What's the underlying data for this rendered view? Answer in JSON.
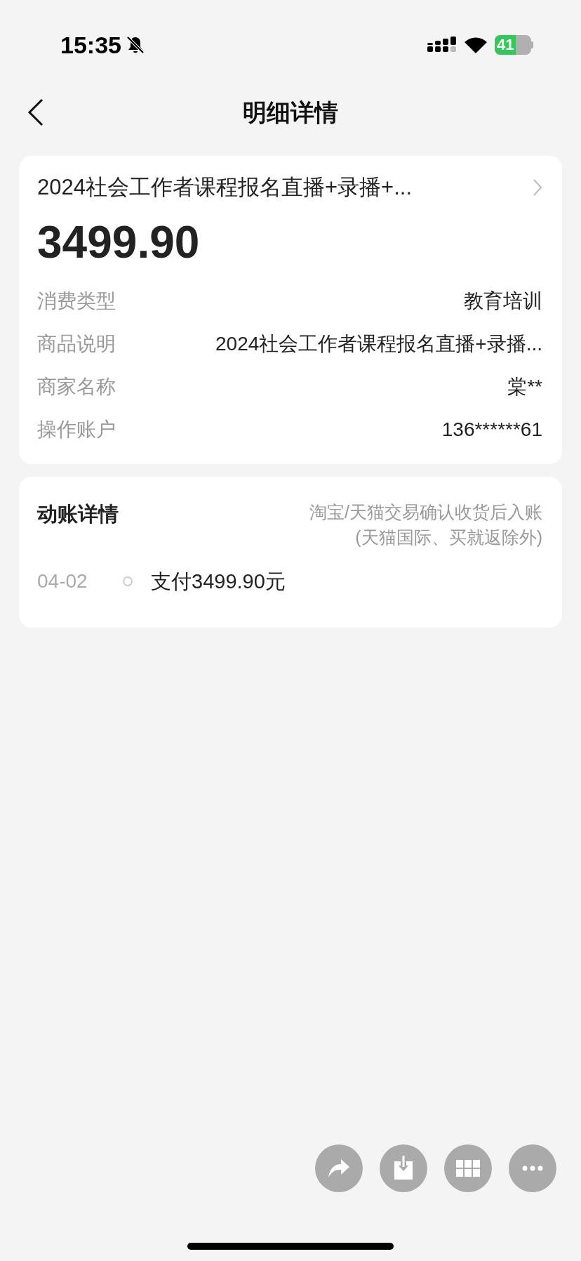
{
  "status_bar": {
    "time": "15:35",
    "battery": "41"
  },
  "header": {
    "title": "明细详情"
  },
  "summary": {
    "title": "2024社会工作者课程报名直播+录播+...",
    "amount": "3499.90",
    "fields": [
      {
        "label": "消费类型",
        "value": "教育培训"
      },
      {
        "label": "商品说明",
        "value": "2024社会工作者课程报名直播+录播..."
      },
      {
        "label": "商家名称",
        "value": "棠**"
      },
      {
        "label": "操作账户",
        "value": "136******61"
      }
    ]
  },
  "account_details": {
    "title": "动账详情",
    "note": [
      "淘宝/天猫交易确认收货后入账",
      "(天猫国际、买就返除外)"
    ],
    "entries": [
      {
        "date": "04-02",
        "text": "支付3499.90元"
      }
    ]
  },
  "actions": [
    {
      "kind": "share"
    },
    {
      "kind": "save"
    },
    {
      "kind": "grid"
    },
    {
      "kind": "more"
    }
  ]
}
